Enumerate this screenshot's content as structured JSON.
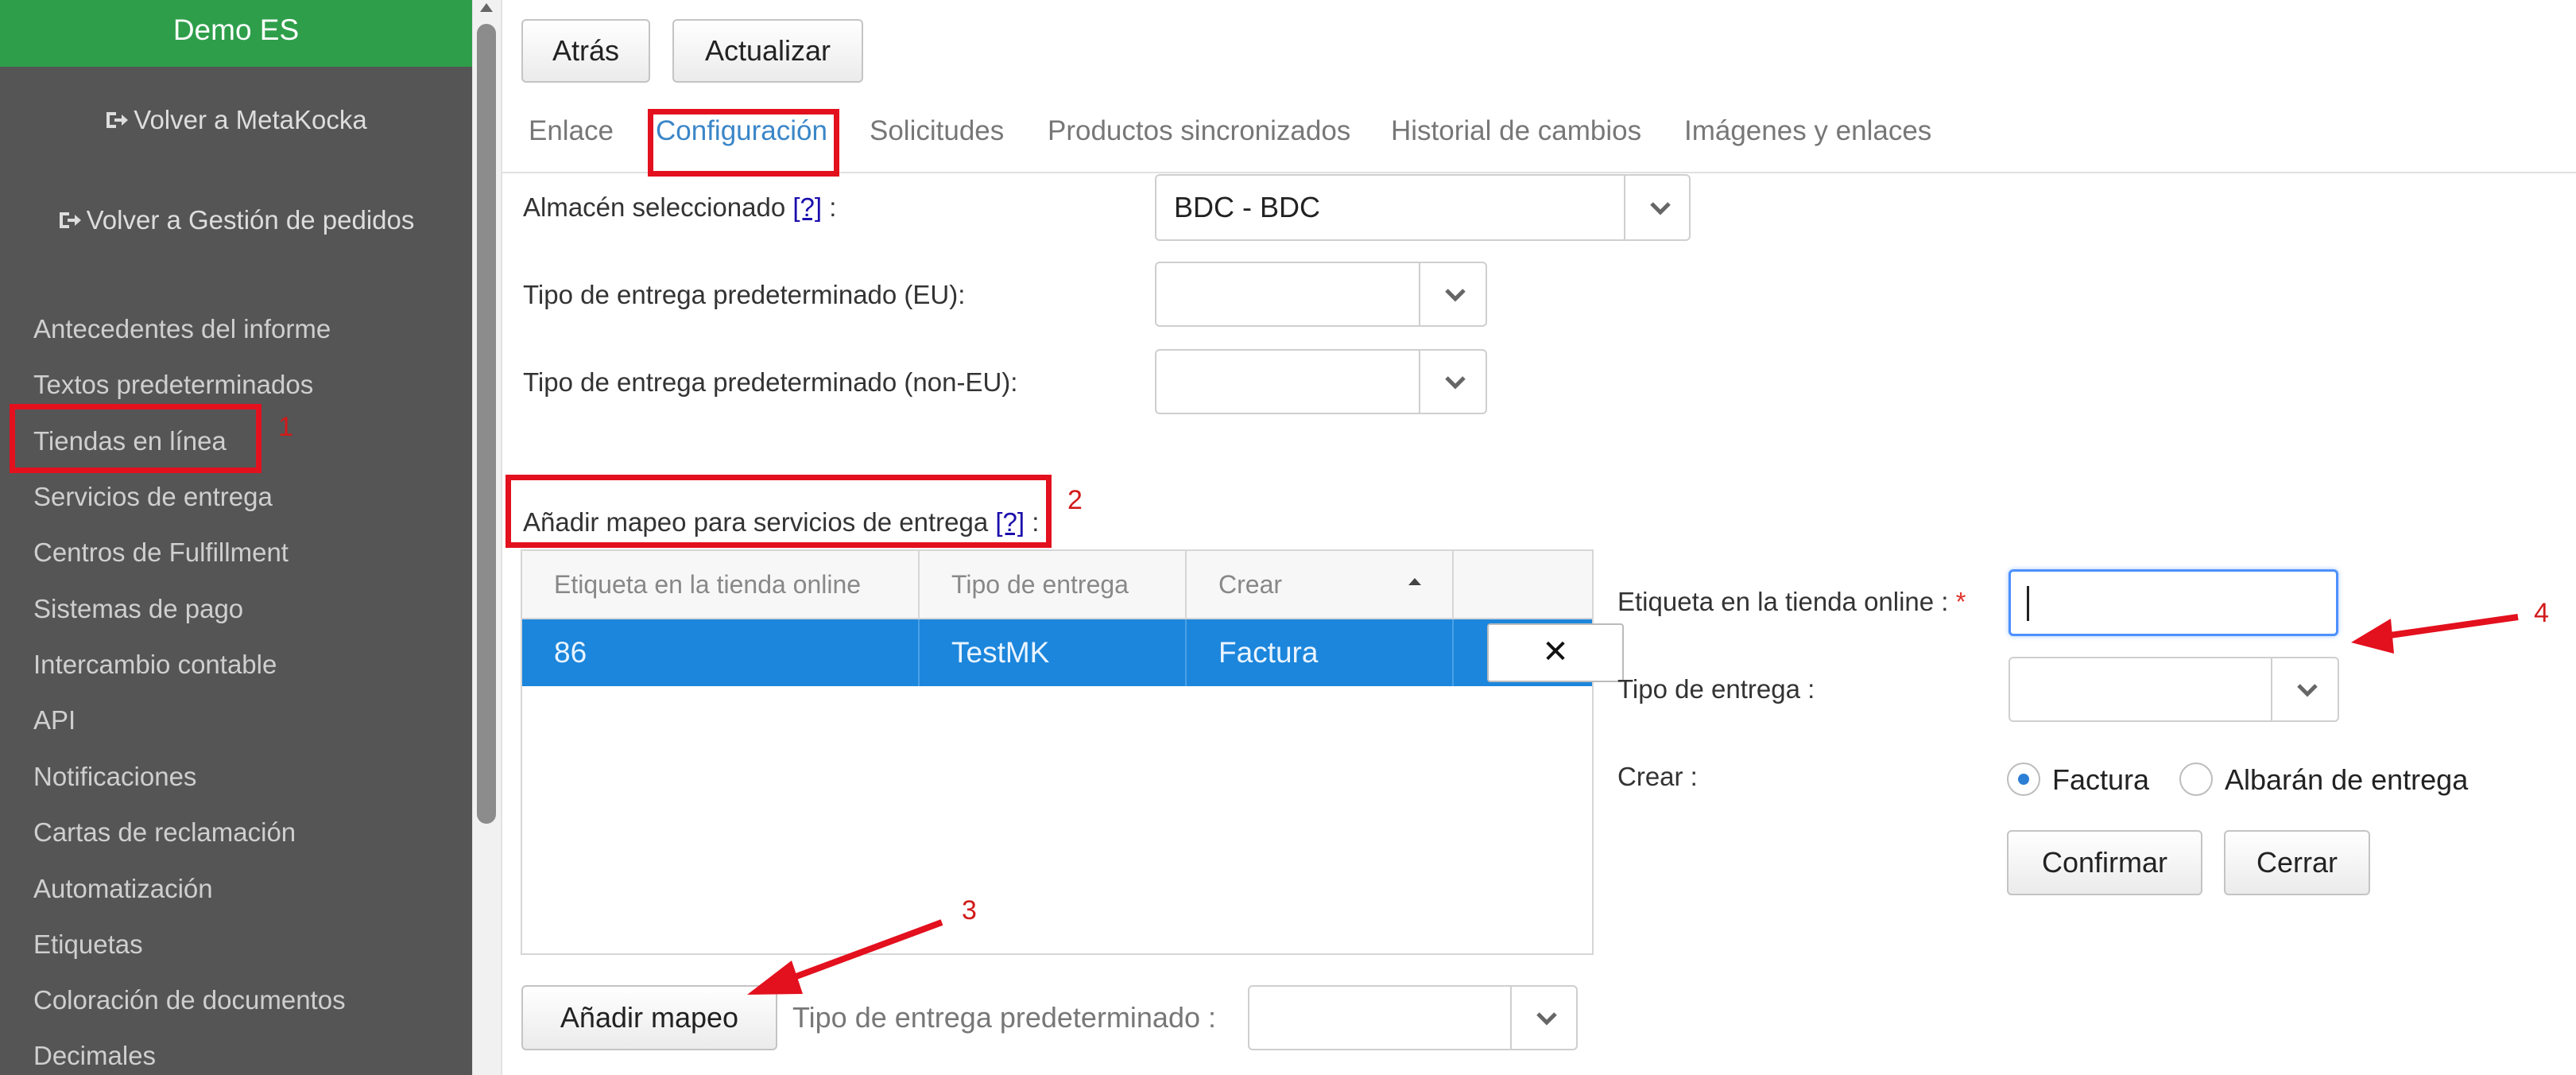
{
  "sidebar": {
    "brand": "Demo ES",
    "back_metakocka": "Volver a MetaKocka",
    "back_orders": "Volver a Gestión de pedidos",
    "items": [
      "Antecedentes del informe",
      "Textos predeterminados",
      "Tiendas en línea",
      "Servicios de entrega",
      "Centros de Fulfillment",
      "Sistemas de pago",
      "Intercambio contable",
      "API",
      "Notificaciones",
      "Cartas de reclamación",
      "Automatización",
      "Etiquetas",
      "Coloración de documentos",
      "Decimales"
    ]
  },
  "toolbar": {
    "back": "Atrás",
    "refresh": "Actualizar"
  },
  "tabs": [
    "Enlace",
    "Configuración",
    "Solicitudes",
    "Productos sincronizados",
    "Historial de cambios",
    "Imágenes y enlaces"
  ],
  "active_tab": "Configuración",
  "settings": {
    "warehouse_label": "Almacén seleccionado",
    "help": "[?]",
    "colon": ":",
    "warehouse_value": "BDC - BDC",
    "delivery_eu_label": "Tipo de entrega predeterminado (EU):",
    "delivery_eu_value": "",
    "delivery_noneu_label": "Tipo de entrega predeterminado (non-EU):",
    "delivery_noneu_value": "",
    "mapping_label": "Añadir mapeo para servicios de entrega"
  },
  "grid": {
    "columns": [
      "Etiqueta en la tienda online",
      "Tipo de entrega",
      "Crear",
      ""
    ],
    "rows": [
      {
        "label": "86",
        "delivery": "TestMK",
        "create": "Factura"
      }
    ],
    "delete_glyph": "✕"
  },
  "form": {
    "online_label": "Etiqueta en la tienda online :",
    "required_mark": "*",
    "online_value": "",
    "delivery_label": "Tipo de entrega :",
    "delivery_value": "",
    "create_label": "Crear :",
    "option_invoice": "Factura",
    "option_delivery_note": "Albarán de entrega",
    "selected_option": "Factura",
    "confirm": "Confirmar",
    "close": "Cerrar"
  },
  "footer": {
    "add_mapping": "Añadir mapeo",
    "default_delivery_label": "Tipo de entrega predeterminado :",
    "default_delivery_value": ""
  },
  "annotations": [
    "1",
    "2",
    "3",
    "4"
  ],
  "colors": {
    "annotation": "#e3101e",
    "brand": "#2f9e4a",
    "sidebar": "#555555",
    "selected_row": "#1c86dc",
    "accent": "#3a86c8"
  },
  "icons": {
    "back_link": "sign-out-icon",
    "select": "chevron-down-icon",
    "sort": "sort-asc-icon",
    "delete": "close-icon"
  }
}
